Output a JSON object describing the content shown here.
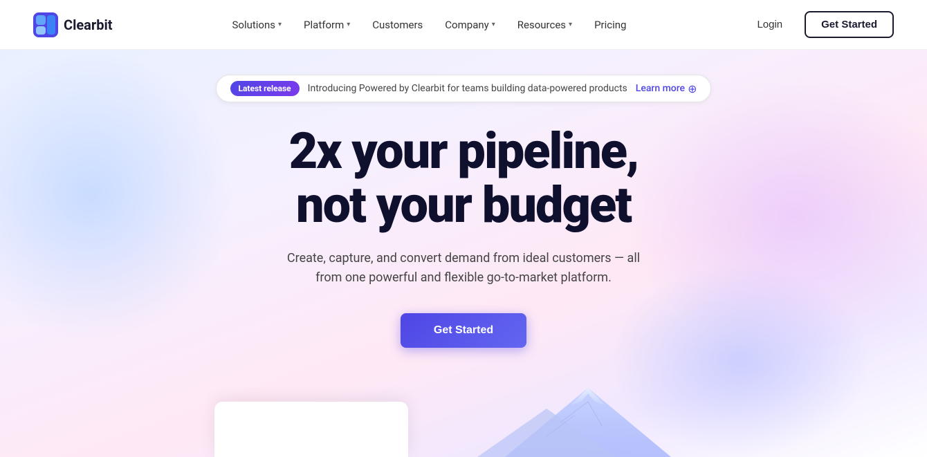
{
  "navbar": {
    "logo_text": "Clearbit",
    "nav_items": [
      {
        "label": "Solutions",
        "has_dropdown": true
      },
      {
        "label": "Platform",
        "has_dropdown": true
      },
      {
        "label": "Customers",
        "has_dropdown": false
      },
      {
        "label": "Company",
        "has_dropdown": true
      },
      {
        "label": "Resources",
        "has_dropdown": true
      },
      {
        "label": "Pricing",
        "has_dropdown": false
      }
    ],
    "login_label": "Login",
    "get_started_label": "Get Started"
  },
  "announcement": {
    "badge_text": "Latest release",
    "message": "Introducing Powered by Clearbit for teams building data-powered products",
    "link_text": "Learn more"
  },
  "hero": {
    "headline_line1": "2x your pipeline,",
    "headline_line2": "not your budget",
    "subheadline": "Create, capture, and convert demand from ideal customers — all from one powerful and flexible go-to-market platform.",
    "cta_label": "Get Started"
  }
}
